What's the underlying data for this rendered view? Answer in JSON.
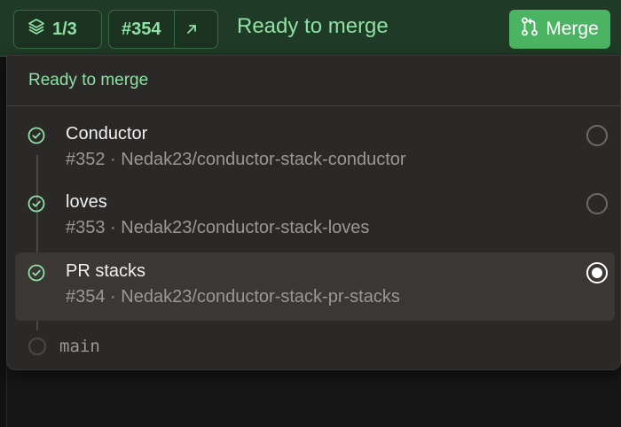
{
  "header": {
    "stack_position": "1/3",
    "pr_number": "#354",
    "status_title": "Ready to merge",
    "merge_label": "Merge"
  },
  "panel": {
    "title": "Ready to merge",
    "items": [
      {
        "name": "Conductor",
        "meta": "#352 · Nedak23/conductor-stack-conductor",
        "status": "passing",
        "selected": false
      },
      {
        "name": "loves",
        "meta": "#353 · Nedak23/conductor-stack-loves",
        "status": "passing",
        "selected": false
      },
      {
        "name": "PR stacks",
        "meta": "#354 · Nedak23/conductor-stack-pr-stacks",
        "status": "passing",
        "selected": true
      }
    ],
    "base_branch": "main"
  },
  "colors": {
    "accent_green": "#8fe0a3",
    "merge_button": "#4bb463",
    "header_bg": "#1f3a26",
    "panel_bg": "#2b2928"
  },
  "icons": {
    "stack": "layers-icon",
    "external": "arrow-up-right-icon",
    "merge": "git-pull-request-icon",
    "check": "check-circle-icon"
  }
}
